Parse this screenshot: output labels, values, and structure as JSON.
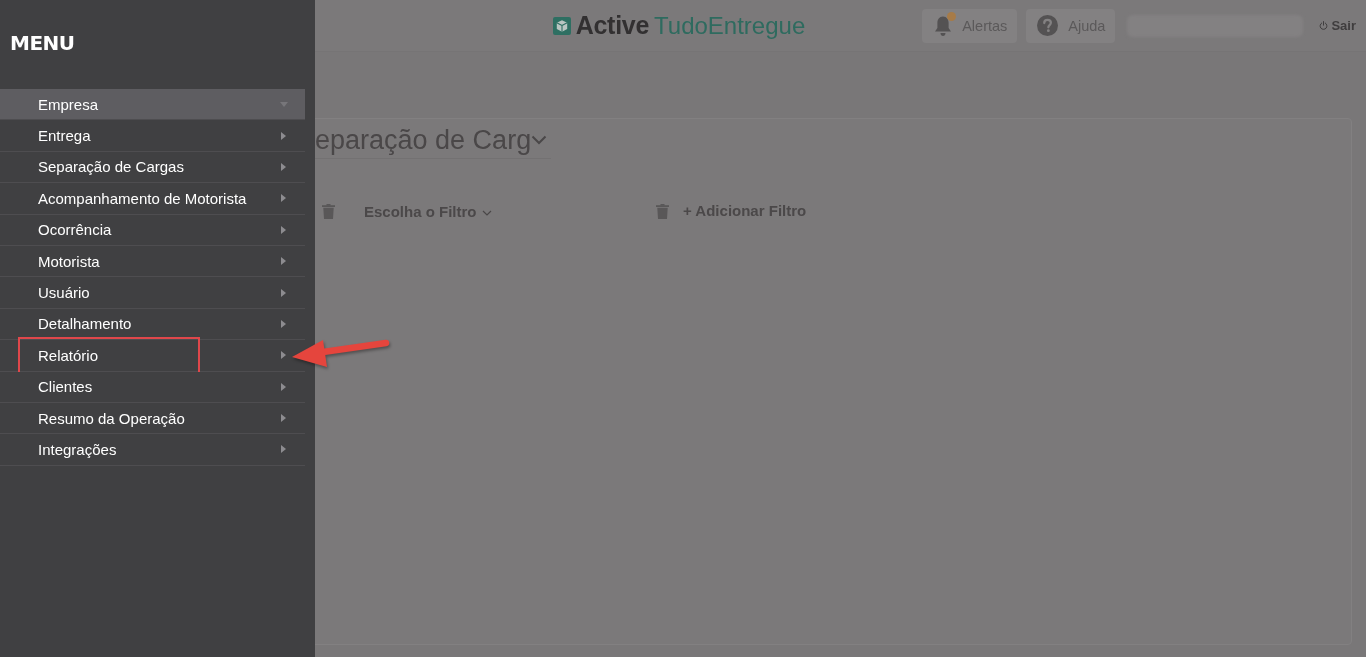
{
  "header": {
    "logo": {
      "brand": "Active",
      "product": "TudoEntregue"
    },
    "buttons": [
      {
        "kind": "alerts",
        "label": "Alertas",
        "badge": true
      },
      {
        "kind": "help",
        "label": "Ajuda",
        "badge": false
      }
    ],
    "logout": "Sair"
  },
  "page": {
    "title_select": {
      "value": "eparação de Carg"
    },
    "filters": [
      {
        "kind": "choose",
        "label": "Escolha o Filtro"
      },
      {
        "kind": "add",
        "label": "+ Adicionar Filtro"
      }
    ]
  },
  "menu": {
    "title": "MENU",
    "items": [
      {
        "label": "Empresa",
        "expanded": true,
        "highlighted": false
      },
      {
        "label": "Entrega",
        "expanded": false,
        "highlighted": false
      },
      {
        "label": "Separação de Cargas",
        "expanded": false,
        "highlighted": false
      },
      {
        "label": "Acompanhamento de Motorista",
        "expanded": false,
        "highlighted": false
      },
      {
        "label": "Ocorrência",
        "expanded": false,
        "highlighted": false
      },
      {
        "label": "Motorista",
        "expanded": false,
        "highlighted": false
      },
      {
        "label": "Usuário",
        "expanded": false,
        "highlighted": false
      },
      {
        "label": "Detalhamento",
        "expanded": false,
        "highlighted": false
      },
      {
        "label": "Relatório",
        "expanded": false,
        "highlighted": true
      },
      {
        "label": "Clientes",
        "expanded": false,
        "highlighted": false
      },
      {
        "label": "Resumo da Operação",
        "expanded": false,
        "highlighted": false
      },
      {
        "label": "Integrações",
        "expanded": false,
        "highlighted": false
      }
    ]
  }
}
